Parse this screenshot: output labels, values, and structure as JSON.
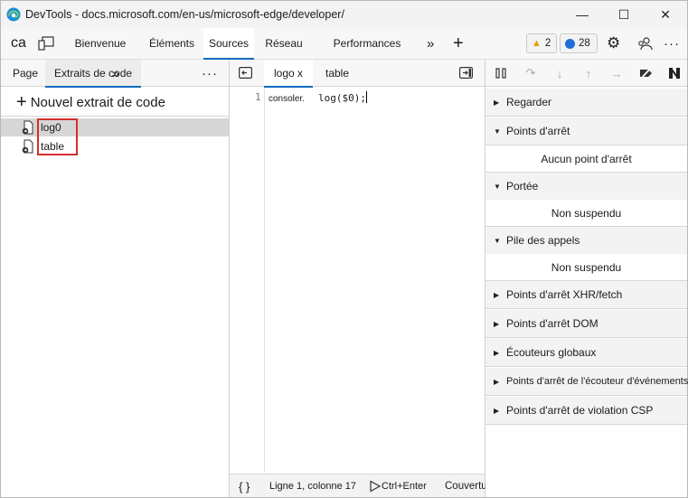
{
  "window": {
    "title": "DevTools - docs.microsoft.com/en-us/microsoft-edge/developer/",
    "minimize_glyph": "—",
    "maximize_glyph": "☐",
    "close_glyph": "✕"
  },
  "toolbar": {
    "ca_label": "ca",
    "tabs": [
      {
        "label": "Bienvenue"
      },
      {
        "label": "Éléments"
      },
      {
        "label": "Sources"
      },
      {
        "label": "Réseau"
      },
      {
        "label": "Performances"
      }
    ],
    "more_glyph": "»",
    "add_glyph": "+",
    "warnings_count": "2",
    "messages_count": "28",
    "gear_glyph": "⚙",
    "dots_glyph": "···"
  },
  "navigator": {
    "tabs": [
      {
        "label": "Page"
      },
      {
        "label": "Extraits de code"
      }
    ],
    "more_glyph": "»",
    "dots_glyph": "···",
    "new_snippet_label": "Nouvel extrait de code",
    "snippets": [
      {
        "name": "log0"
      },
      {
        "name": "table"
      }
    ]
  },
  "editor": {
    "tabs": [
      {
        "label": "logo x"
      },
      {
        "label": "table"
      }
    ],
    "line_number": "1",
    "code_part1": "consoler.",
    "code_part2": "log($0);",
    "status": {
      "braces": "{ }",
      "position": "Ligne 1, colonne 17",
      "run": "Ctrl+Enter",
      "coverage": "Couverture"
    }
  },
  "debugger": {
    "sections": [
      {
        "label": "Regarder",
        "expanded": false
      },
      {
        "label": "Points d'arrêt",
        "expanded": true,
        "message": "Aucun point d'arrêt"
      },
      {
        "label": "Portée",
        "expanded": true,
        "message": "Non suspendu"
      },
      {
        "label": "Pile des appels",
        "expanded": true,
        "message": "Non suspendu"
      },
      {
        "label": "Points d'arrêt XHR/fetch",
        "expanded": false
      },
      {
        "label": "Points d'arrêt DOM",
        "expanded": false
      },
      {
        "label": "Écouteurs globaux",
        "expanded": false
      },
      {
        "label": "Points d'arrêt de l'écouteur d'événements",
        "expanded": false
      },
      {
        "label": "Points d'arrêt de violation CSP",
        "expanded": false
      }
    ],
    "collapsed_glyph": "▶",
    "expanded_glyph": "▼"
  },
  "colors": {
    "accent": "#0f6cbd",
    "highlight_box": "#d32f2f",
    "selected_row": "#d6d6d6",
    "warning": "#e0a100",
    "message": "#1f6fd6"
  }
}
